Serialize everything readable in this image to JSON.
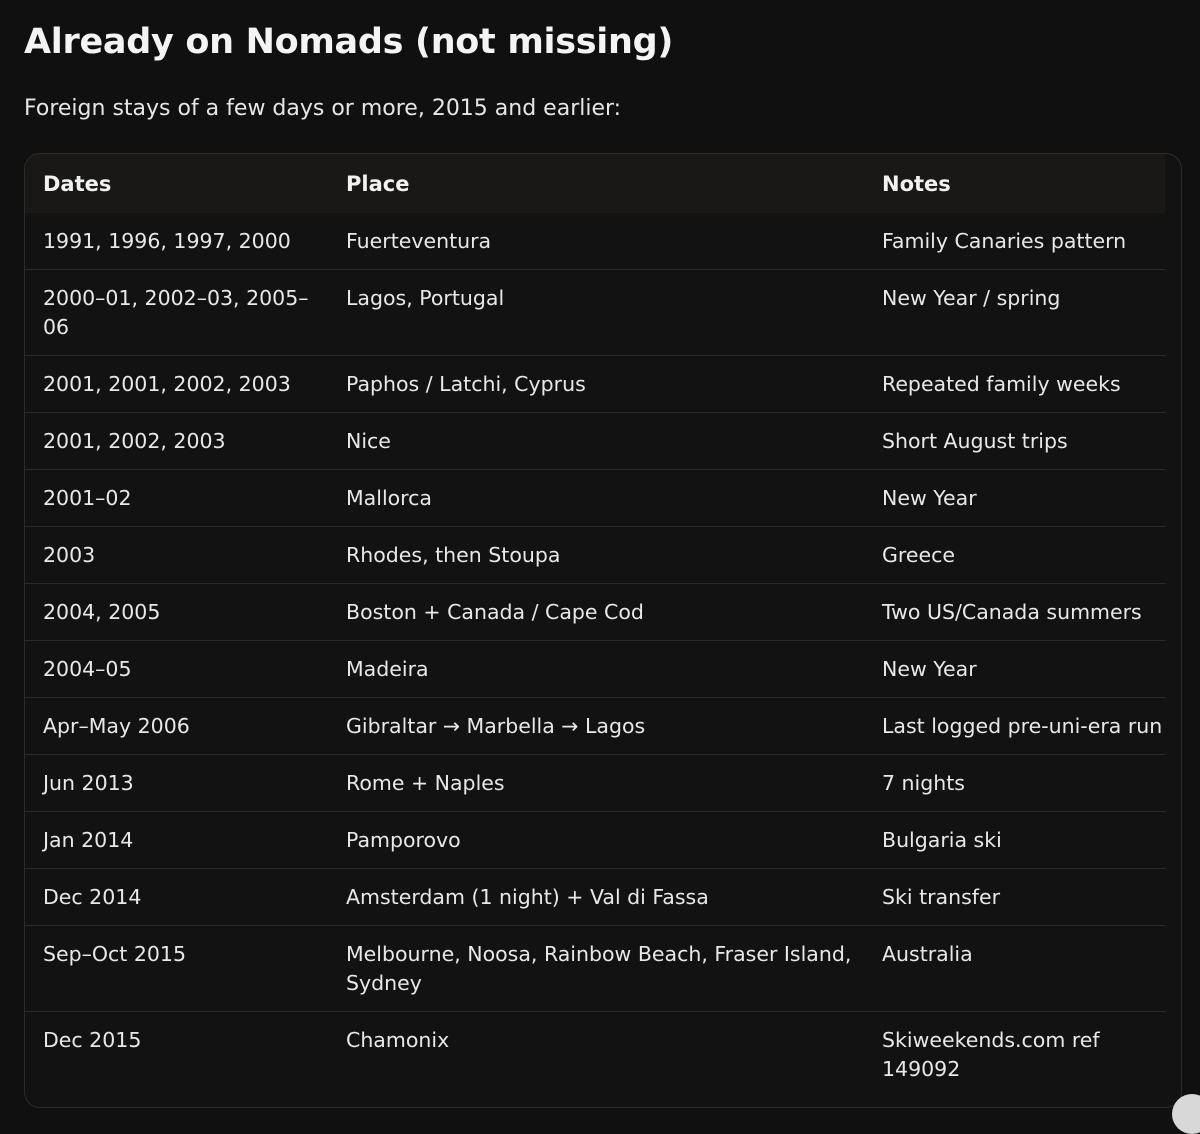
{
  "heading": "Already on Nomads (not missing)",
  "intro": "Foreign stays of a few days or more, 2015 and earlier:",
  "table": {
    "headers": {
      "dates": "Dates",
      "place": "Place",
      "notes": "Notes"
    },
    "rows": [
      {
        "dates": "1991, 1996, 1997, 2000",
        "place": "Fuerteventura",
        "notes": "Family Canaries pattern"
      },
      {
        "dates": "2000–01, 2002–03, 2005–06",
        "place": "Lagos, Portugal",
        "notes": "New Year / spring"
      },
      {
        "dates": "2001, 2001, 2002, 2003",
        "place": "Paphos / Latchi, Cyprus",
        "notes": "Repeated family weeks"
      },
      {
        "dates": "2001, 2002, 2003",
        "place": "Nice",
        "notes": "Short August trips"
      },
      {
        "dates": "2001–02",
        "place": "Mallorca",
        "notes": "New Year"
      },
      {
        "dates": "2003",
        "place": "Rhodes, then Stoupa",
        "notes": "Greece"
      },
      {
        "dates": "2004, 2005",
        "place": "Boston + Canada / Cape Cod",
        "notes": "Two US/Canada summers"
      },
      {
        "dates": "2004–05",
        "place": "Madeira",
        "notes": "New Year"
      },
      {
        "dates": "Apr–May 2006",
        "place": "Gibraltar → Marbella → Lagos",
        "notes": "Last logged pre-uni-era run"
      },
      {
        "dates": "Jun 2013",
        "place": "Rome + Naples",
        "notes": "7 nights"
      },
      {
        "dates": "Jan 2014",
        "place": "Pamporovo",
        "notes": "Bulgaria ski"
      },
      {
        "dates": "Dec 2014",
        "place": "Amsterdam (1 night) + Val di Fassa",
        "notes": "Ski transfer"
      },
      {
        "dates": "Sep–Oct 2015",
        "place": "Melbourne, Noosa, Rainbow Beach, Fraser Island, Sydney",
        "notes": "Australia"
      },
      {
        "dates": "Dec 2015",
        "place": "Chamonix",
        "notes": "Skiweekends.com ref 149092"
      }
    ]
  }
}
